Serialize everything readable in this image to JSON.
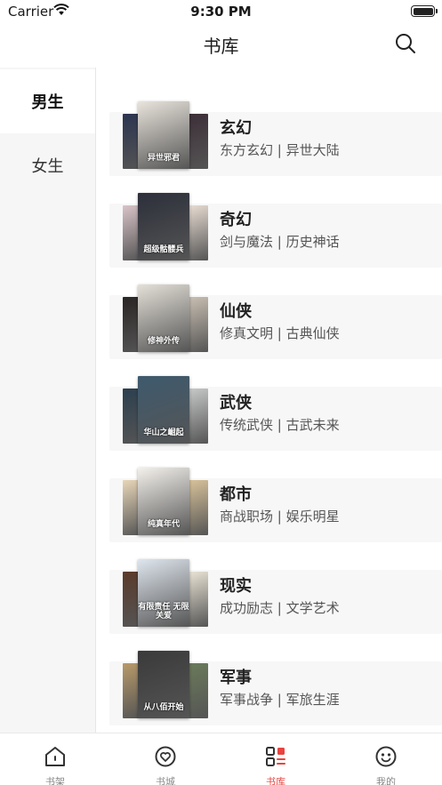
{
  "status_bar": {
    "carrier": "Carrier",
    "time": "9:30 PM"
  },
  "nav": {
    "title": "书库",
    "search_icon": "search-icon"
  },
  "sidebar": {
    "items": [
      {
        "label": "男生",
        "active": true
      },
      {
        "label": "女生",
        "active": false
      }
    ]
  },
  "categories": [
    {
      "name": "玄幻",
      "tags": "东方玄幻 | 异世大陆",
      "cover_text": "异世邪君",
      "colors": [
        "#2b3450",
        "#e9e4dc",
        "#3d2f38"
      ]
    },
    {
      "name": "奇幻",
      "tags": "剑与魔法 | 历史神话",
      "cover_text": "超级骷髅兵",
      "colors": [
        "#d9c3c8",
        "#2c2f3a",
        "#e8dcd2"
      ]
    },
    {
      "name": "仙侠",
      "tags": "修真文明 | 古典仙侠",
      "cover_text": "修神外传",
      "colors": [
        "#2a2424",
        "#e4e0d8",
        "#c9bfb2"
      ]
    },
    {
      "name": "武侠",
      "tags": "传统武侠 | 古武未来",
      "cover_text": "华山之崛起",
      "colors": [
        "#2b3f4f",
        "#3e5a6e",
        "#c7c8c8"
      ]
    },
    {
      "name": "都市",
      "tags": "商战职场 | 娱乐明星",
      "cover_text": "纯真年代",
      "colors": [
        "#e8d6b8",
        "#f4f1ec",
        "#d8c29a"
      ]
    },
    {
      "name": "现实",
      "tags": "成功励志 | 文学艺术",
      "cover_text": "有限责任 无限关爱",
      "colors": [
        "#5a3a2a",
        "#dfe6ee",
        "#e9e3d5"
      ]
    },
    {
      "name": "军事",
      "tags": "军事战争 | 军旅生涯",
      "cover_text": "从八佰开始",
      "colors": [
        "#b89a6a",
        "#3a3a3a",
        "#6b7a5a"
      ]
    }
  ],
  "tab_bar": {
    "items": [
      {
        "label": "书架",
        "icon": "bookshelf-icon",
        "active": false
      },
      {
        "label": "书城",
        "icon": "bookstore-icon",
        "active": false
      },
      {
        "label": "书库",
        "icon": "library-icon",
        "active": true
      },
      {
        "label": "我的",
        "icon": "profile-icon",
        "active": false
      }
    ]
  },
  "colors": {
    "accent": "#e8433f",
    "card_bg": "#f7f7f7",
    "sidebar_bg": "#f6f6f6"
  }
}
